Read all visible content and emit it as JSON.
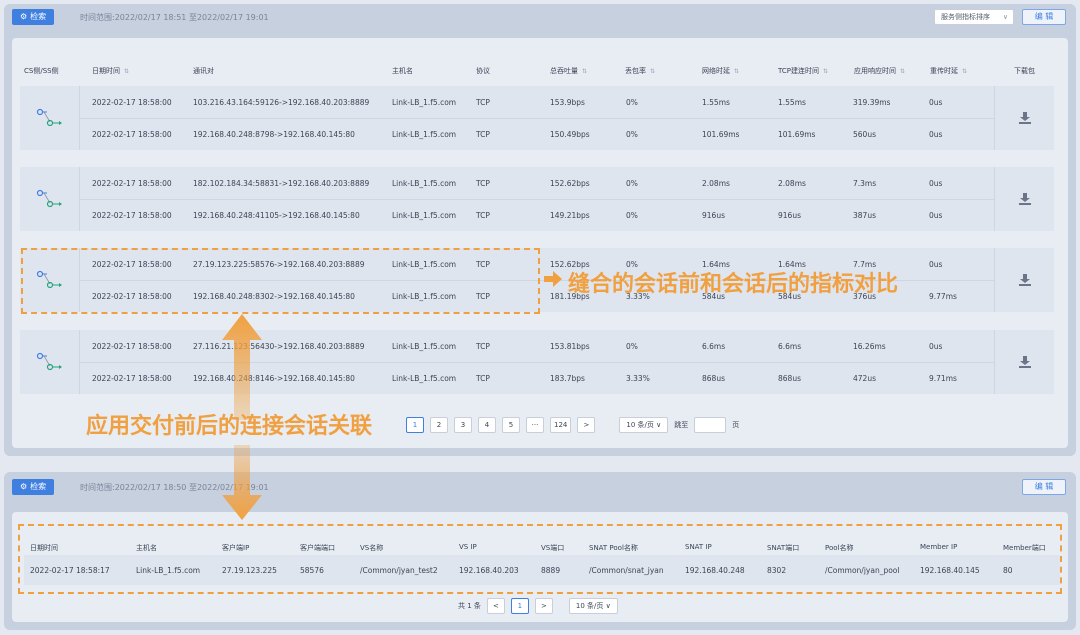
{
  "top": {
    "search_label": "检索",
    "time_range": "时间范围:2022/02/17 18:51 至2022/02/17 19:01",
    "sort_select": "服务侧指标排序",
    "edit_label": "编 辑",
    "headers": [
      "CS侧/SS侧",
      "日期时间",
      "通讯对",
      "主机名",
      "协议",
      "总吞吐量",
      "丢包率",
      "网络时延",
      "TCP建连时间",
      "应用响应时间",
      "重传时延",
      "下载包"
    ],
    "groups": [
      {
        "rows": [
          [
            "2022-02-17 18:58:00",
            "103.216.43.164:59126->192.168.40.203:8889",
            "Link-LB_1.f5.com",
            "TCP",
            "153.9bps",
            "0%",
            "1.55ms",
            "1.55ms",
            "319.39ms",
            "0us"
          ],
          [
            "2022-02-17 18:58:00",
            "192.168.40.248:8798->192.168.40.145:80",
            "Link-LB_1.f5.com",
            "TCP",
            "150.49bps",
            "0%",
            "101.69ms",
            "101.69ms",
            "560us",
            "0us"
          ]
        ]
      },
      {
        "rows": [
          [
            "2022-02-17 18:58:00",
            "182.102.184.34:58831->192.168.40.203:8889",
            "Link-LB_1.f5.com",
            "TCP",
            "152.62bps",
            "0%",
            "2.08ms",
            "2.08ms",
            "7.3ms",
            "0us"
          ],
          [
            "2022-02-17 18:58:00",
            "192.168.40.248:41105->192.168.40.145:80",
            "Link-LB_1.f5.com",
            "TCP",
            "149.21bps",
            "0%",
            "916us",
            "916us",
            "387us",
            "0us"
          ]
        ]
      },
      {
        "rows": [
          [
            "2022-02-17 18:58:00",
            "27.19.123.225:58576->192.168.40.203:8889",
            "Link-LB_1.f5.com",
            "TCP",
            "152.62bps",
            "0%",
            "1.64ms",
            "1.64ms",
            "7.7ms",
            "0us"
          ],
          [
            "2022-02-17 18:58:00",
            "192.168.40.248:8302->192.168.40.145:80",
            "Link-LB_1.f5.com",
            "TCP",
            "181.19bps",
            "3.33%",
            "584us",
            "584us",
            "376us",
            "9.77ms"
          ]
        ]
      },
      {
        "rows": [
          [
            "2022-02-17 18:58:00",
            "27.116.21.123:56430->192.168.40.203:8889",
            "Link-LB_1.f5.com",
            "TCP",
            "153.81bps",
            "0%",
            "6.6ms",
            "6.6ms",
            "16.26ms",
            "0us"
          ],
          [
            "2022-02-17 18:58:00",
            "192.168.40.248:8146->192.168.40.145:80",
            "Link-LB_1.f5.com",
            "TCP",
            "183.7bps",
            "3.33%",
            "868us",
            "868us",
            "472us",
            "9.71ms"
          ]
        ]
      }
    ],
    "pager": {
      "pages": [
        "1",
        "2",
        "3",
        "4",
        "5",
        "···",
        "124"
      ],
      "next": ">",
      "size": "10 条/页 ∨",
      "jump": "跳至",
      "page_unit": "页"
    }
  },
  "annotations": {
    "compare": "缝合的会话前和会话后的指标对比",
    "link": "应用交付前后的连接会话关联"
  },
  "bottom": {
    "search_label": "检索",
    "time_range": "时间范围:2022/02/17 18:50 至2022/02/17 19:01",
    "edit_label": "编 辑",
    "headers": [
      "日期时间",
      "主机名",
      "客户端IP",
      "客户端端口",
      "VS名称",
      "VS IP",
      "VS端口",
      "SNAT Pool名称",
      "SNAT IP",
      "SNAT端口",
      "Pool名称",
      "Member IP",
      "Member端口"
    ],
    "row": [
      "2022-02-17 18:58:17",
      "Link-LB_1.f5.com",
      "27.19.123.225",
      "58576",
      "/Common/jyan_test2",
      "192.168.40.203",
      "8889",
      "/Common/snat_jyan",
      "192.168.40.248",
      "8302",
      "/Common/jyan_pool",
      "192.168.40.145",
      "80"
    ],
    "pager": {
      "total": "共 1 条",
      "prev": "<",
      "page": "1",
      "next": ">",
      "size": "10 条/页 ∨"
    }
  },
  "colors": {
    "accent": "#3f7fe0",
    "annotation": "#f0a040"
  },
  "icons": [
    "gear-icon",
    "link-icon",
    "download-icon",
    "double-arrow-icon",
    "right-arrow-icon"
  ]
}
